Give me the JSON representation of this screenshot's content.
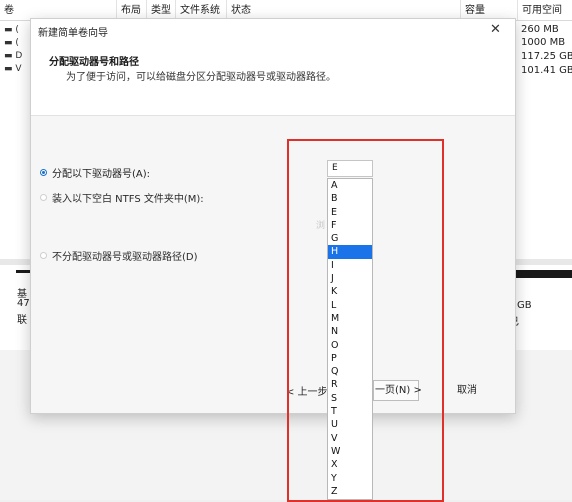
{
  "background": {
    "columns": [
      "卷",
      "布局",
      "类型",
      "文件系统",
      "状态",
      "容量",
      "可用空间"
    ],
    "free_space_values": [
      "260 MB",
      "1000 MB",
      "117.25 GB",
      "101.41 GB"
    ],
    "row_markers": [
      "(",
      "(",
      "D",
      "V"
    ],
    "lower_left": [
      "基",
      "47",
      "联"
    ],
    "lower_right": [
      "GB",
      "已"
    ]
  },
  "dialog": {
    "title": "新建简单卷向导",
    "close_glyph": "✕",
    "heading": "分配驱动器号和路径",
    "subheading": "为了便于访问，可以给磁盘分区分配驱动器号或驱动器路径。",
    "options": [
      {
        "label": "分配以下驱动器号(A):",
        "checked": true
      },
      {
        "label": "装入以下空白 NTFS 文件夹中(M):",
        "checked": false
      },
      {
        "label": "不分配驱动器号或驱动器路径(D)",
        "checked": false
      }
    ],
    "drive_letter": {
      "selected_value": "E",
      "options": [
        "A",
        "B",
        "E",
        "F",
        "G",
        "H",
        "I",
        "J",
        "K",
        "L",
        "M",
        "N",
        "O",
        "P",
        "Q",
        "R",
        "S",
        "T",
        "U",
        "V",
        "W",
        "X",
        "Y",
        "Z"
      ],
      "highlighted": "H"
    },
    "faint_glyph": "浏",
    "buttons": {
      "back": "< 上一步",
      "next": "一页(N) >",
      "cancel": "取消"
    }
  },
  "annotation": {
    "color": "#e0302a"
  }
}
